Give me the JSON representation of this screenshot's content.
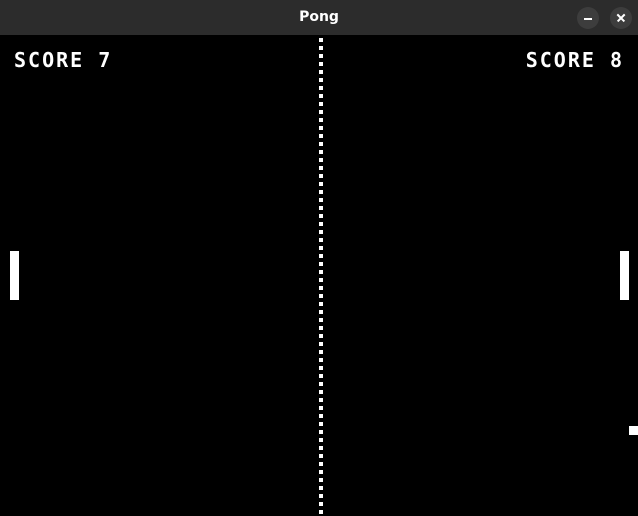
{
  "window": {
    "title": "Pong",
    "controls": [
      "minimize-icon",
      "close-icon"
    ]
  },
  "game": {
    "left_score_label": "SCORE 7",
    "right_score_label": "SCORE 8",
    "left_score": 7,
    "right_score": 8
  },
  "colors": {
    "background": "#000000",
    "foreground": "#ffffff",
    "titlebar": "#2c2c2c",
    "titlebar_button": "#3d3d3d"
  }
}
